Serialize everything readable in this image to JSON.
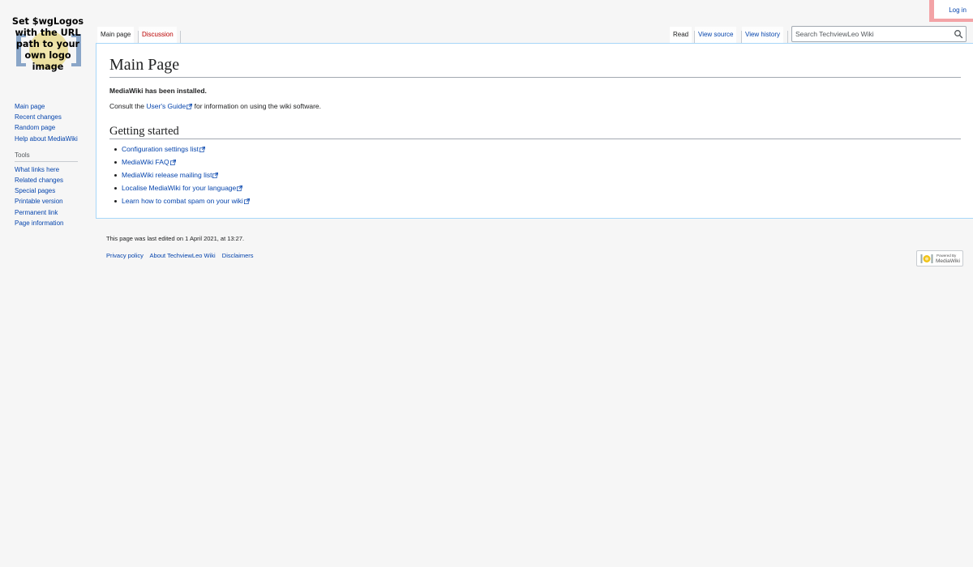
{
  "personal_tools": {
    "login_label": "Log in"
  },
  "logo": {
    "text": "Set $wgLogos with the URL path to your own logo image"
  },
  "sidebar": {
    "navigation": [
      {
        "label": "Main page"
      },
      {
        "label": "Recent changes"
      },
      {
        "label": "Random page"
      },
      {
        "label": "Help about MediaWiki"
      }
    ],
    "tools_heading": "Tools",
    "tools": [
      {
        "label": "What links here"
      },
      {
        "label": "Related changes"
      },
      {
        "label": "Special pages"
      },
      {
        "label": "Printable version"
      },
      {
        "label": "Permanent link"
      },
      {
        "label": "Page information"
      }
    ]
  },
  "tabs": {
    "left": [
      {
        "label": "Main page"
      },
      {
        "label": "Discussion"
      }
    ],
    "right": [
      {
        "label": "Read"
      },
      {
        "label": "View source"
      },
      {
        "label": "View history"
      }
    ]
  },
  "search": {
    "placeholder": "Search TechviewLeo Wiki",
    "icon": "search-icon"
  },
  "content": {
    "title": "Main Page",
    "installed": "MediaWiki has been installed.",
    "consult_prefix": "Consult the ",
    "users_guide_link": "User's Guide",
    "consult_suffix": " for information on using the wiki software.",
    "getting_started_heading": "Getting started",
    "links": [
      {
        "label": "Configuration settings list"
      },
      {
        "label": "MediaWiki FAQ"
      },
      {
        "label": "MediaWiki release mailing list"
      },
      {
        "label": "Localise MediaWiki for your language"
      },
      {
        "label": "Learn how to combat spam on your wiki"
      }
    ]
  },
  "footer": {
    "last_edited": "This page was last edited on 1 April 2021, at 13:27.",
    "places": [
      {
        "label": "Privacy policy"
      },
      {
        "label": "About TechviewLeo Wiki"
      },
      {
        "label": "Disclaimers"
      }
    ],
    "powered_small": "Powered By",
    "powered_main": "MediaWiki"
  },
  "colors": {
    "link": "#0645ad",
    "new_link": "#ba0000",
    "highlight": "#f3a3a6"
  }
}
